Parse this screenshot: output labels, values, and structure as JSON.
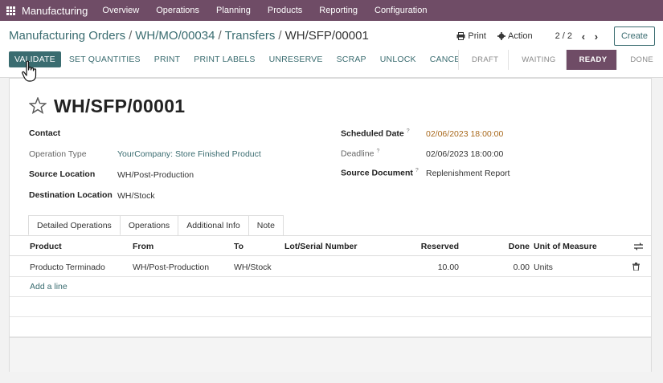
{
  "navbar": {
    "app_name": "Manufacturing",
    "menu": [
      "Overview",
      "Operations",
      "Planning",
      "Products",
      "Reporting",
      "Configuration"
    ]
  },
  "breadcrumb": {
    "items": [
      "Manufacturing Orders",
      "WH/MO/00034",
      "Transfers"
    ],
    "current": "WH/SFP/00001"
  },
  "toolbar": {
    "print_label": "Print",
    "action_label": "Action",
    "pager": "2 / 2",
    "create_label": "Create"
  },
  "actions": {
    "validate": "VALIDATE",
    "set_quantities": "SET QUANTITIES",
    "print": "PRINT",
    "print_labels": "PRINT LABELS",
    "unreserve": "UNRESERVE",
    "scrap": "SCRAP",
    "unlock": "UNLOCK",
    "cancel": "CANCEL"
  },
  "statusbar": {
    "states": [
      "DRAFT",
      "WAITING",
      "READY",
      "DONE"
    ],
    "active": "READY"
  },
  "record": {
    "name": "WH/SFP/00001",
    "contact_label": "Contact",
    "operation_type_label": "Operation Type",
    "operation_type_value": "YourCompany: Store Finished Product",
    "source_location_label": "Source Location",
    "source_location_value": "WH/Post-Production",
    "destination_location_label": "Destination Location",
    "destination_location_value": "WH/Stock",
    "scheduled_date_label": "Scheduled Date",
    "scheduled_date_value": "02/06/2023 18:00:00",
    "deadline_label": "Deadline",
    "deadline_value": "02/06/2023 18:00:00",
    "source_document_label": "Source Document",
    "source_document_value": "Replenishment Report",
    "help_marker": "?"
  },
  "tabs": [
    "Detailed Operations",
    "Operations",
    "Additional Info",
    "Note"
  ],
  "table": {
    "headers": {
      "product": "Product",
      "from": "From",
      "to": "To",
      "lot": "Lot/Serial Number",
      "reserved": "Reserved",
      "done": "Done",
      "uom": "Unit of Measure"
    },
    "rows": [
      {
        "product": "Producto Terminado",
        "from": "WH/Post-Production",
        "to": "WH/Stock",
        "lot": "",
        "reserved": "10.00",
        "done": "0.00",
        "uom": "Units"
      }
    ],
    "add_line": "Add a line"
  },
  "colors": {
    "brand": "#6f4c66",
    "primary": "#3a6c70",
    "warning_date": "#a8681b"
  }
}
